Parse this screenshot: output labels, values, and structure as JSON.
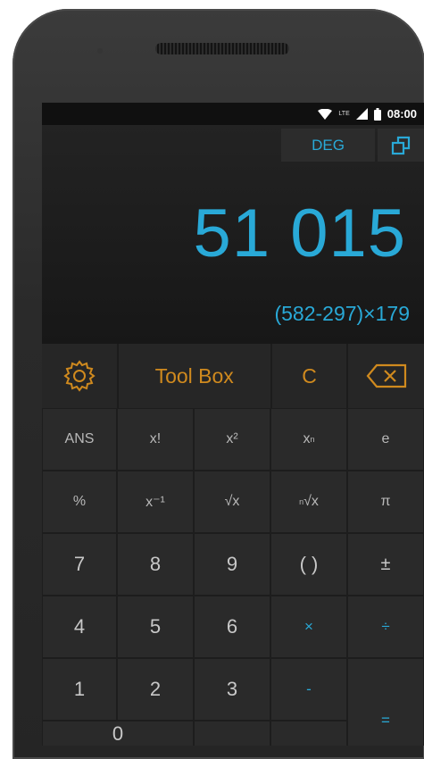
{
  "status": {
    "network": "LTE",
    "time": "08:00"
  },
  "display": {
    "mode": "DEG",
    "result": "51 015",
    "expression": "(582-297)×179"
  },
  "toolbar": {
    "toolbox_label": "Tool Box",
    "clear_label": "C"
  },
  "keys": {
    "ans": "ANS",
    "factorial": "x!",
    "square": "x²",
    "power_base": "x",
    "power_exp": "n",
    "e": "e",
    "percent": "%",
    "inverse": "x⁻¹",
    "sqrt": "√x",
    "root_exp": "n",
    "root_base": "√x",
    "pi": "π",
    "n7": "7",
    "n8": "8",
    "n9": "9",
    "paren": "( )",
    "plusminus": "±",
    "n4": "4",
    "n5": "5",
    "n6": "6",
    "multiply": "×",
    "divide": "÷",
    "n1": "1",
    "n2": "2",
    "n3": "3",
    "minus": "-",
    "equals": "=",
    "n0": "0"
  },
  "colors": {
    "accent_blue": "#29a9d7",
    "accent_orange": "#d08a1e",
    "key_bg": "#2a2a2a"
  }
}
